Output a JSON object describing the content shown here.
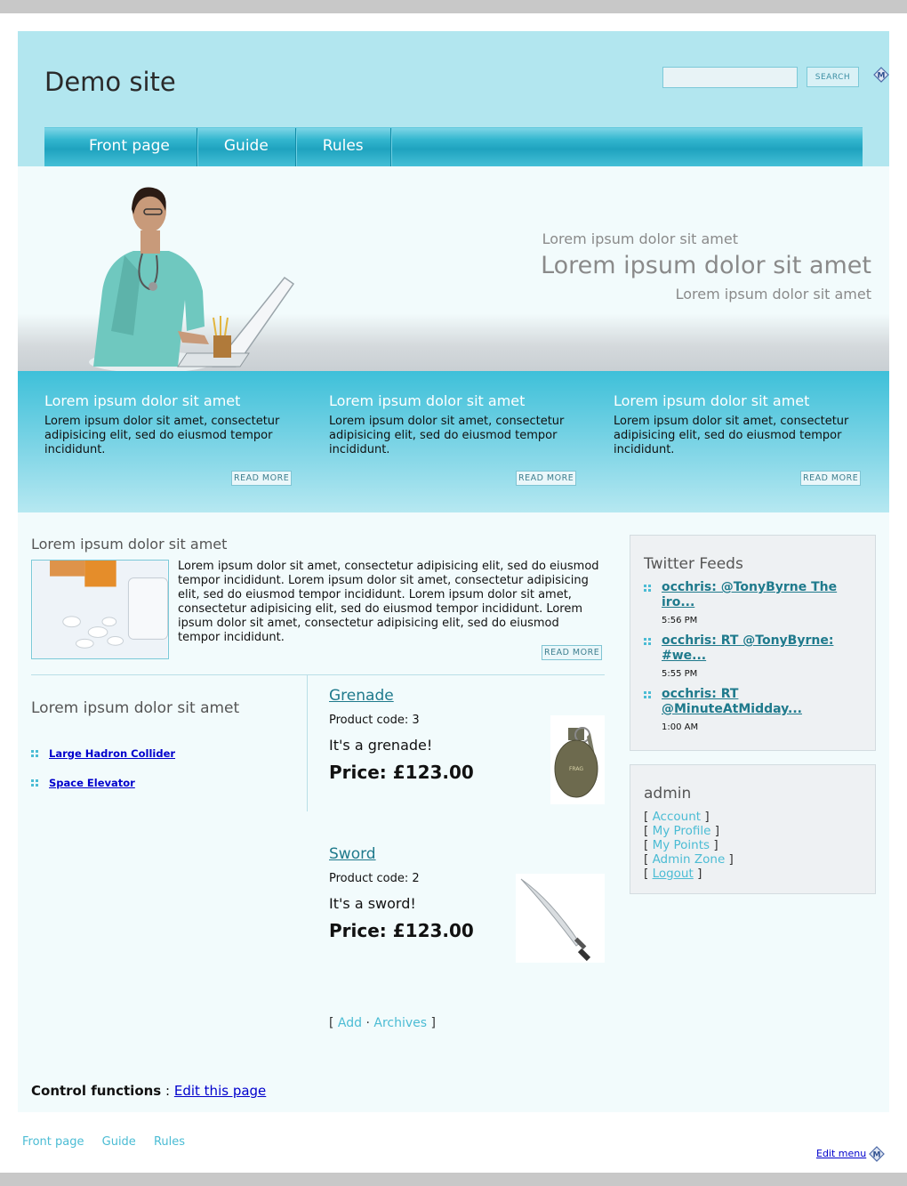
{
  "site": {
    "title": "Demo site"
  },
  "search": {
    "value": "",
    "placeholder": "",
    "button_label": "SEARCH"
  },
  "nav": {
    "items": [
      "Front page",
      "Guide",
      "Rules"
    ]
  },
  "banner": {
    "line1": "Lorem ipsum dolor sit amet",
    "line2": "Lorem ipsum dolor sit amet",
    "line3": "Lorem ipsum dolor sit amet"
  },
  "teasers": [
    {
      "title": "Lorem ipsum dolor sit amet",
      "text": "Lorem ipsum dolor sit amet, consectetur adipisicing elit, sed do eiusmod tempor incididunt.",
      "read_more": "READ MORE"
    },
    {
      "title": "Lorem ipsum dolor sit amet",
      "text": "Lorem ipsum dolor sit amet, consectetur adipisicing elit, sed do eiusmod tempor incididunt.",
      "read_more": "READ MORE"
    },
    {
      "title": "Lorem ipsum dolor sit amet",
      "text": "Lorem ipsum dolor sit amet, consectetur adipisicing elit, sed do eiusmod tempor incididunt.",
      "read_more": "READ MORE"
    }
  ],
  "article": {
    "title": "Lorem ipsum dolor sit amet",
    "text": "Lorem ipsum dolor sit amet, consectetur adipisicing elit, sed do eiusmod tempor incididunt. Lorem ipsum dolor sit amet, consectetur adipisicing elit, sed do eiusmod tempor incididunt. Lorem ipsum dolor sit amet, consectetur adipisicing elit, sed do eiusmod tempor incididunt. Lorem ipsum dolor sit amet, consectetur adipisicing elit, sed do eiusmod tempor incididunt.",
    "read_more": "READ MORE"
  },
  "links_block": {
    "title": "Lorem ipsum dolor sit amet",
    "items": [
      "Large Hadron Collider",
      "Space Elevator"
    ]
  },
  "products": [
    {
      "name": "Grenade",
      "code": "Product code: 3",
      "description": "It's a grenade!",
      "price": "Price: £123.00"
    },
    {
      "name": "Sword",
      "code": "Product code: 2",
      "description": "It's a sword!",
      "price": "Price: £123.00"
    }
  ],
  "product_actions": {
    "open": "[",
    "add": "Add",
    "sep": "·",
    "archives": "Archives",
    "close": "]"
  },
  "control": {
    "label": "Control functions",
    "sep": ":",
    "link": "Edit this page"
  },
  "twitter": {
    "title": "Twitter Feeds",
    "items": [
      {
        "text": "occhris: @TonyByrne The iro...",
        "time": "5:56 PM"
      },
      {
        "text": "occhris: RT @TonyByrne: #we...",
        "time": "5:55 PM"
      },
      {
        "text": "occhris: RT @MinuteAtMidday...",
        "time": "1:00 AM"
      }
    ]
  },
  "admin": {
    "title": "admin",
    "links": [
      "Account",
      "My Profile",
      "My Points",
      "Admin Zone",
      "Logout"
    ]
  },
  "footer": {
    "links": [
      "Front page",
      "Guide",
      "Rules"
    ],
    "edit_menu": "Edit menu"
  },
  "colors": {
    "header_bg": "#b2e6ef",
    "accent": "#4bbcd4",
    "nav": "#1fa3bf",
    "main_bg": "#f2fbfc"
  },
  "icons": [
    "m-logo-icon",
    "bullet-icon"
  ]
}
